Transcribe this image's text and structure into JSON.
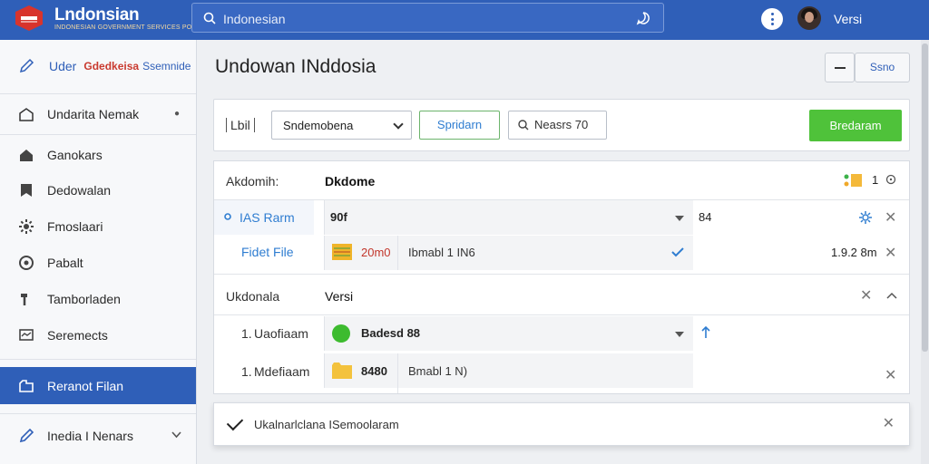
{
  "app": {
    "title": "Lndonsian",
    "subtitle": "INDONESIAN GOVERNMENT SERVICES PORTAL"
  },
  "search": {
    "value": "Indonesian"
  },
  "user": {
    "name": "Versi"
  },
  "sidebar": {
    "top": {
      "label1": "Uder",
      "label2": "Gdedkeisa",
      "label3": "Ssemnide"
    },
    "items": [
      {
        "label": "Undarita Nemak",
        "icon": "inbox-icon"
      },
      {
        "label": "Ganokars",
        "icon": "home-icon"
      },
      {
        "label": "Dedowalan",
        "icon": "bookmark-icon"
      },
      {
        "label": "Fmoslaari",
        "icon": "gear-icon"
      },
      {
        "label": "Pabalt",
        "icon": "location-icon"
      },
      {
        "label": "Tamborladen",
        "icon": "hammer-icon"
      },
      {
        "label": "Seremects",
        "icon": "screen-icon"
      },
      {
        "label": "Reranot Filan",
        "icon": "folder-icon"
      },
      {
        "label": "Inedia I Nenars",
        "icon": "pencil-icon"
      }
    ]
  },
  "main": {
    "title": "Undowan INddosia",
    "top_button": "Ssno",
    "toolbar": {
      "label": "Lbil",
      "select_value": "Sndemobena",
      "link_label": "Spridarn",
      "search_label": "Neasrs 70",
      "primary_label": "Bredaram"
    },
    "panel": {
      "section1": {
        "label": "Akdomih:",
        "value": "Dkdome",
        "badge_count": "1",
        "rows": [
          {
            "label": "IAS Rarm",
            "select_value": "90f",
            "right_value": "84"
          },
          {
            "label": "Fidet File",
            "value": "20m0",
            "desc": "Ibmabl 1 IN6",
            "right_value": "1.9.2 8m"
          }
        ]
      },
      "section2": {
        "label": "Ukdonala",
        "value": "Versi",
        "rows": [
          {
            "num": "1.",
            "label": "Uaofiaam",
            "value": "Badesd 88"
          },
          {
            "num": "1.",
            "label": "Mdefiaam",
            "value": "8480",
            "desc": "Bmabl 1 N)"
          }
        ]
      }
    },
    "bottom_bar": {
      "text": "Ukalnarlclana ISemoolaram"
    }
  }
}
